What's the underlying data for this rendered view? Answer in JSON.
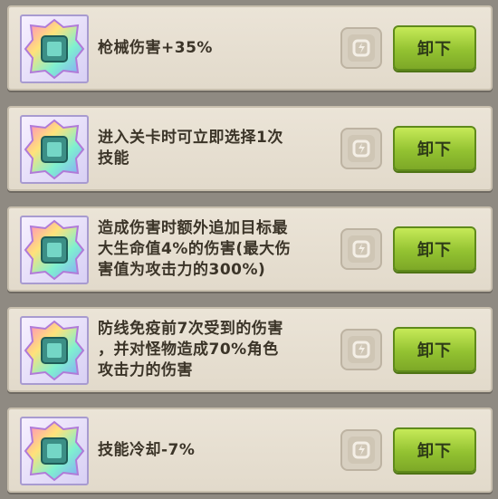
{
  "skills": [
    {
      "description": "枪械伤害+35%",
      "button_label": "卸下",
      "icon": "prism-gem-icon",
      "lock_icon": "lock-icon"
    },
    {
      "description": "进入关卡时可立即选择1次\n技能",
      "button_label": "卸下",
      "icon": "prism-gem-icon",
      "lock_icon": "lock-icon"
    },
    {
      "description": "造成伤害时额外追加目标最\n大生命值4%的伤害(最大伤\n害值为攻击力的300%)",
      "button_label": "卸下",
      "icon": "prism-gem-icon",
      "lock_icon": "lock-icon"
    },
    {
      "description": "防线免疫前7次受到的伤害\n，并对怪物造成70%角色\n攻击力的伤害",
      "button_label": "卸下",
      "icon": "prism-gem-icon",
      "lock_icon": "lock-icon"
    },
    {
      "description": "技能冷却-7%",
      "button_label": "卸下",
      "icon": "prism-gem-icon",
      "lock_icon": "lock-icon"
    }
  ],
  "colors": {
    "panel_bg": "#8f8a82",
    "row_bg": "#ebe4d7",
    "button_green": "#93c231",
    "text": "#3b3428"
  }
}
